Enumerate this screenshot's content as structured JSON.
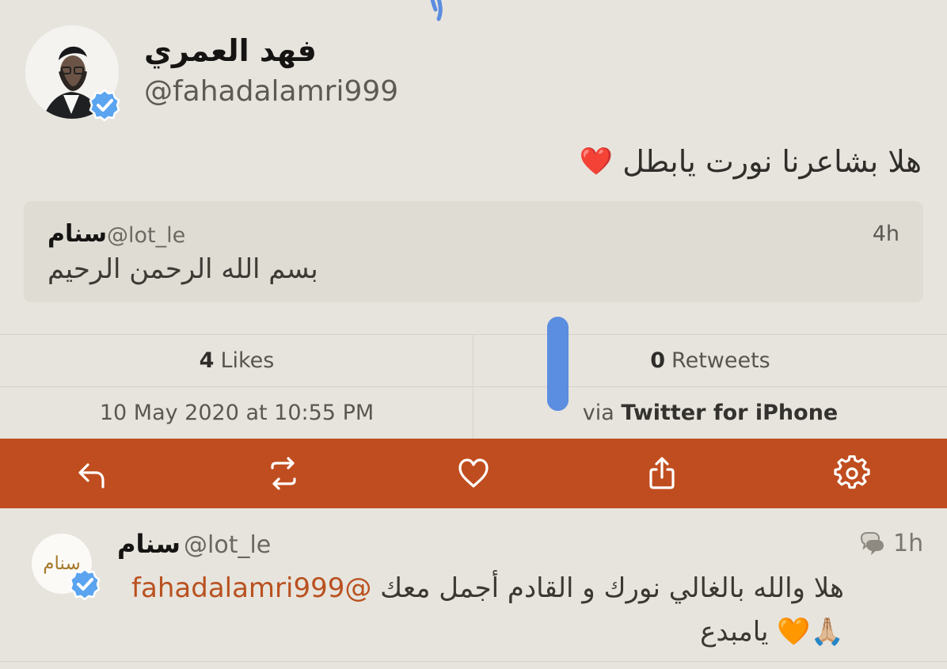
{
  "tweet": {
    "author_name": "فهد العمري",
    "author_handle": "@fahadalamri999",
    "text": "هلا بشاعرنا نورت يابطل",
    "emoji": "❤️",
    "quoted": {
      "name": "سنام",
      "handle": "@lot_le",
      "time": "4h",
      "text": "بسم الله الرحمن الرحيم"
    },
    "likes_count": "4",
    "likes_label": "Likes",
    "retweets_count": "0",
    "retweets_label": "Retweets",
    "timestamp": "10 May 2020 at 10:55 PM",
    "via_prefix": "via",
    "source": "Twitter for iPhone"
  },
  "actions": [
    {
      "name": "reply",
      "icon": "reply-icon"
    },
    {
      "name": "retweet",
      "icon": "retweet-icon"
    },
    {
      "name": "like",
      "icon": "heart-icon"
    },
    {
      "name": "share",
      "icon": "share-icon"
    },
    {
      "name": "settings",
      "icon": "gear-icon"
    }
  ],
  "reply": {
    "name": "سنام",
    "handle": "@lot_le",
    "time": "1h",
    "text_prefix": "هلا والله بالغالي نورك و القادم أجمل معك ",
    "mention": "@fahadalamri999",
    "line2": "🙏🏼🧡 يامبدع",
    "avatar_text": "سنام"
  },
  "colors": {
    "background": "#e7e4dd",
    "action_bar": "#c04d1f",
    "verified": "#5aa4f0",
    "mention": "#b9511f"
  }
}
